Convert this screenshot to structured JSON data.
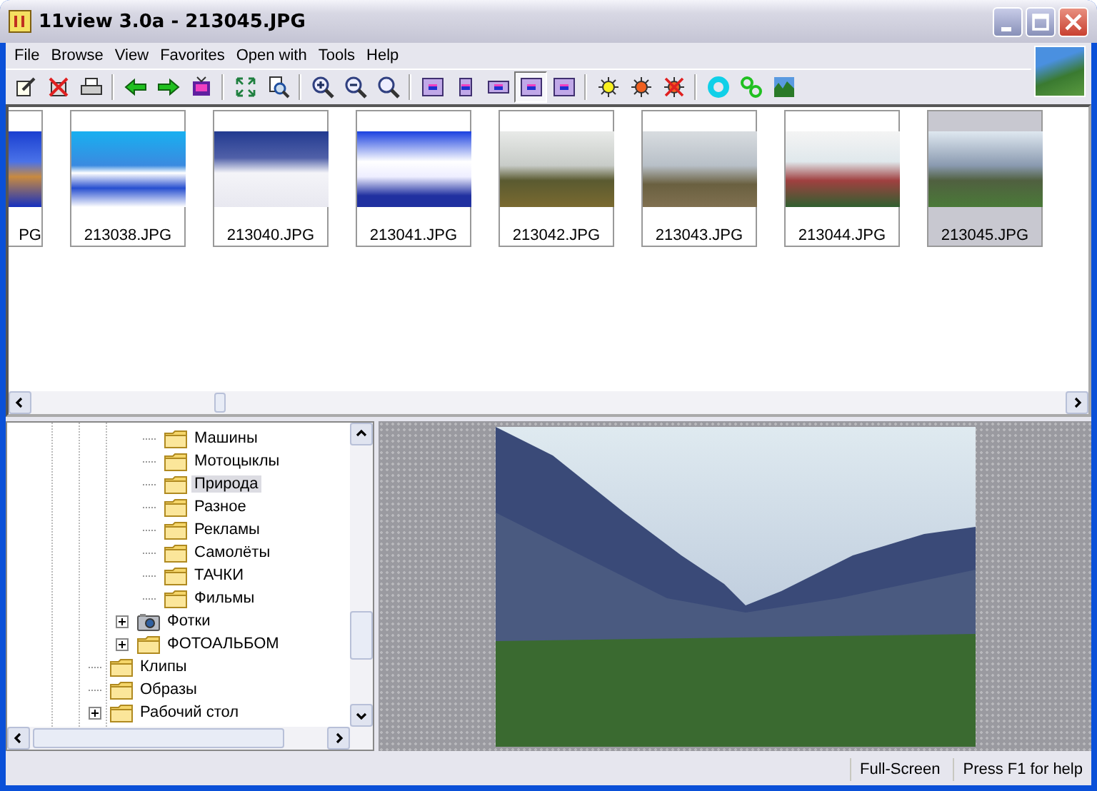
{
  "window": {
    "title": "11view 3.0a - 213045.JPG"
  },
  "menu": [
    {
      "label": "File"
    },
    {
      "label": "Browse"
    },
    {
      "label": "View"
    },
    {
      "label": "Favorites"
    },
    {
      "label": "Open with"
    },
    {
      "label": "Tools"
    },
    {
      "label": "Help"
    }
  ],
  "toolbar": [
    {
      "kind": "edit",
      "selected": false
    },
    {
      "kind": "delete",
      "selected": false
    },
    {
      "kind": "print",
      "selected": false
    },
    {
      "kind": "separator"
    },
    {
      "kind": "back",
      "selected": false
    },
    {
      "kind": "forward",
      "selected": false
    },
    {
      "kind": "monitor",
      "selected": false
    },
    {
      "kind": "separator"
    },
    {
      "kind": "fit",
      "selected": false
    },
    {
      "kind": "find",
      "selected": false
    },
    {
      "kind": "separator"
    },
    {
      "kind": "zoom-in",
      "selected": false
    },
    {
      "kind": "zoom-out",
      "selected": false
    },
    {
      "kind": "zoom",
      "selected": false
    },
    {
      "kind": "separator"
    },
    {
      "kind": "layout-small",
      "selected": false
    },
    {
      "kind": "layout-tall",
      "selected": false
    },
    {
      "kind": "layout-wide",
      "selected": false
    },
    {
      "kind": "layout-framed",
      "selected": true
    },
    {
      "kind": "layout-side",
      "selected": false
    },
    {
      "kind": "separator"
    },
    {
      "kind": "sun",
      "selected": false
    },
    {
      "kind": "sun-red",
      "selected": false
    },
    {
      "kind": "sun-off",
      "selected": false
    },
    {
      "kind": "separator"
    },
    {
      "kind": "ring",
      "selected": false
    },
    {
      "kind": "gears",
      "selected": false
    },
    {
      "kind": "picture",
      "selected": false
    }
  ],
  "thumbnails": [
    {
      "name": "PG",
      "selected": false,
      "partial": true
    },
    {
      "name": "213038.JPG",
      "selected": false
    },
    {
      "name": "213040.JPG",
      "selected": false
    },
    {
      "name": "213041.JPG",
      "selected": false
    },
    {
      "name": "213042.JPG",
      "selected": false
    },
    {
      "name": "213043.JPG",
      "selected": false
    },
    {
      "name": "213044.JPG",
      "selected": false
    },
    {
      "name": "213045.JPG",
      "selected": true
    }
  ],
  "tree": [
    {
      "kind": "hidden",
      "children": [
        {
          "kind": "hidden",
          "children": [
            {
              "label": "Машины",
              "kind": "folder",
              "expandable": false,
              "selected": false
            },
            {
              "label": "Мотоцыклы",
              "kind": "folder",
              "expandable": false,
              "selected": false
            },
            {
              "label": "Природа",
              "kind": "folder",
              "expandable": false,
              "selected": true
            },
            {
              "label": "Разное",
              "kind": "folder",
              "expandable": false,
              "selected": false
            },
            {
              "label": "Рекламы",
              "kind": "folder",
              "expandable": false,
              "selected": false
            },
            {
              "label": "Самолёты",
              "kind": "folder",
              "expandable": false,
              "selected": false
            },
            {
              "label": "ТАЧКИ",
              "kind": "folder",
              "expandable": false,
              "selected": false
            },
            {
              "label": "Фильмы",
              "kind": "folder",
              "expandable": false,
              "selected": false
            }
          ]
        },
        {
          "label": "Фотки",
          "kind": "camera",
          "expandable": true,
          "selected": false
        },
        {
          "label": "ФОТОАЛЬБОМ",
          "kind": "folder",
          "expandable": true,
          "selected": false
        }
      ]
    },
    {
      "label": "Клипы",
      "kind": "folder",
      "expandable": false,
      "selected": false
    },
    {
      "label": "Образы",
      "kind": "folder",
      "expandable": false,
      "selected": false
    },
    {
      "label": "Рабочий стол",
      "kind": "folder",
      "expandable": true,
      "selected": false
    }
  ],
  "status_bar": [
    "Full-Screen",
    "Press F1 for help"
  ]
}
